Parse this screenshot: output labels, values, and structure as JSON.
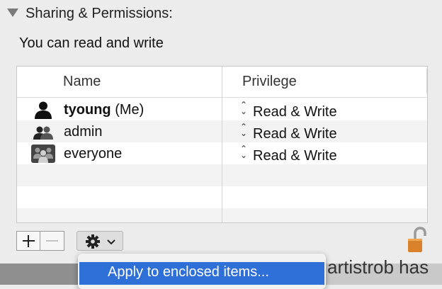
{
  "section": {
    "title": "Sharing & Permissions:",
    "access_text": "You can read and write"
  },
  "table": {
    "columns": {
      "name": "Name",
      "privilege": "Privilege"
    },
    "rows": [
      {
        "user": "tyoung",
        "user_suffix": " (Me)",
        "privilege": "Read & Write",
        "icon": "single-user-icon"
      },
      {
        "user": "admin",
        "privilege": "Read & Write",
        "icon": "group-user-icon"
      },
      {
        "user": "everyone",
        "privilege": "Read & Write",
        "icon": "everyone-icon"
      }
    ]
  },
  "toolbar": {
    "add_icon": "plus-icon",
    "remove_icon": "minus-icon",
    "action_icon": "gear-icon",
    "action_chevron": "chevron-down-icon",
    "lock_icon": "lock-open-icon",
    "stepper_glyph": "⌃⌄"
  },
  "menu": {
    "items": [
      {
        "label": "Apply to enclosed items...",
        "highlighted": true
      }
    ]
  },
  "background": {
    "partial_text": "artistrob has"
  },
  "colors": {
    "highlight": "#2f6fd8",
    "lock_body": "#d9822b",
    "lock_shackle": "#9a9a9a"
  }
}
